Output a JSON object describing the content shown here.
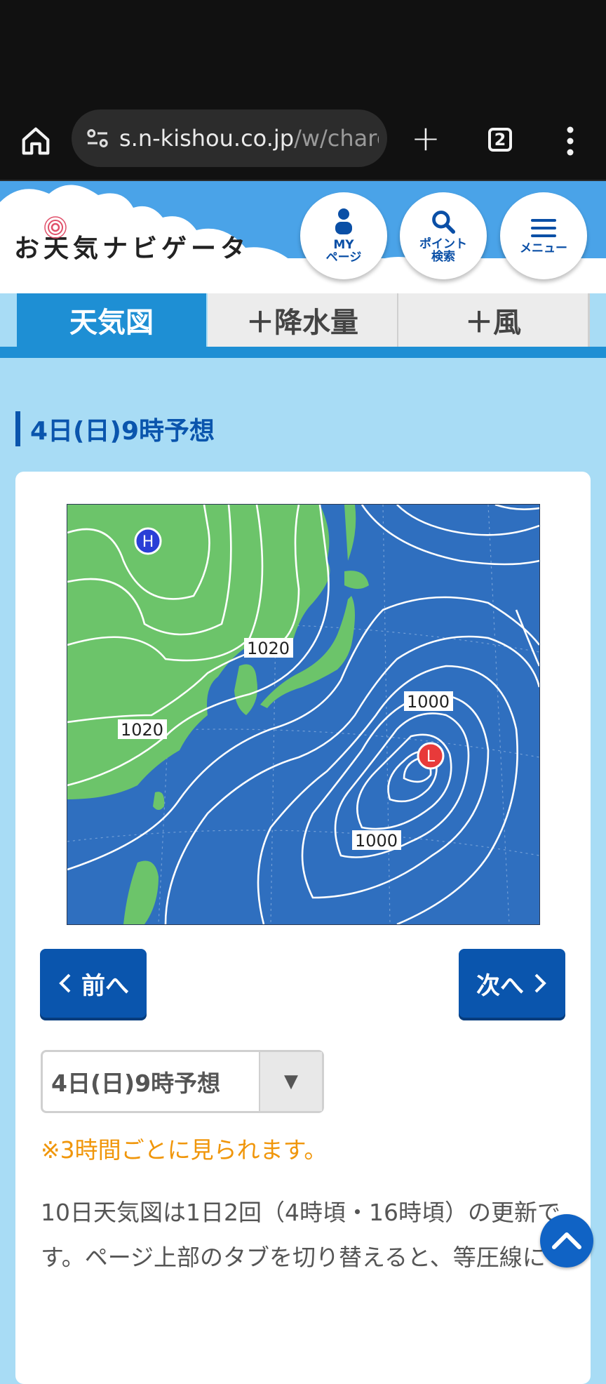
{
  "browser": {
    "url_domain": "s.n-kishou.co.jp",
    "url_path": "/w/charg",
    "tab_count": "2"
  },
  "header": {
    "logo_text": "お天気ナビゲータ",
    "my_page_label_1": "MY",
    "my_page_label_2": "ページ",
    "point_search_label_1": "ポイント",
    "point_search_label_2": "検索",
    "menu_label": "メニュー"
  },
  "tabs": [
    {
      "label": "天気図",
      "active": true
    },
    {
      "label": "＋降水量",
      "active": false
    },
    {
      "label": "＋風",
      "active": false
    }
  ],
  "section_title": "4日(日)9時予想",
  "map": {
    "high_label": "H",
    "low_label": "L",
    "isobar_labels": [
      "1020",
      "1020",
      "1000",
      "1000"
    ],
    "colors": {
      "sea": "#2f6fbf",
      "land": "#6cc46a",
      "high": "#2a3fd6",
      "low": "#e83a3a"
    }
  },
  "nav": {
    "prev_label": "前へ",
    "next_label": "次へ"
  },
  "select": {
    "value": "4日(日)9時予想"
  },
  "note": "※3時間ごとに見られます。",
  "description": "10日天気図は1日2回（4時頃・16時頃）の更新です。ページ上部のタブを切り替えると、等圧線に",
  "colors": {
    "accent": "#1e8fd4",
    "button": "#0a55ad",
    "note": "#f0960a",
    "background": "#a8dcf5"
  }
}
